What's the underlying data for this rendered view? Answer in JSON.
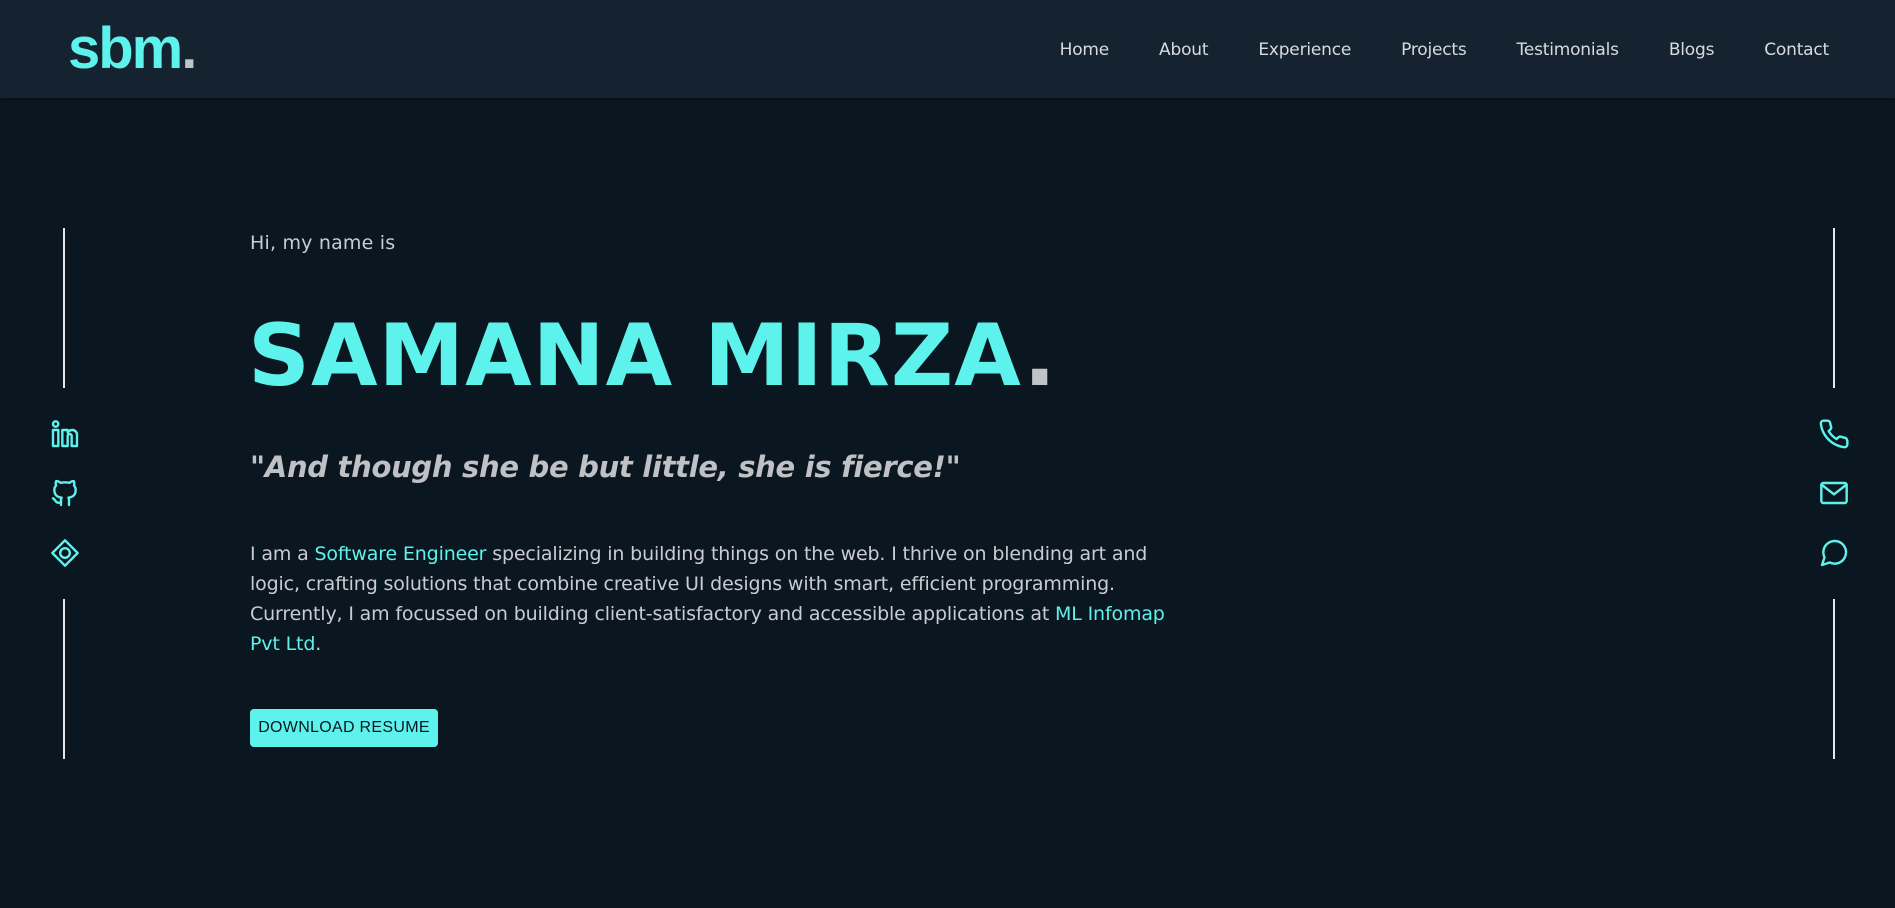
{
  "header": {
    "logo_text": "sbm",
    "logo_dot": ".",
    "nav": [
      "Home",
      "About",
      "Experience",
      "Projects",
      "Testimonials",
      "Blogs",
      "Contact"
    ]
  },
  "hero": {
    "greeting": "Hi, my name is",
    "name": "SAMANA MIRZA",
    "name_dot": ".",
    "quote": "\"And though she be but little, she is fierce!\"",
    "bio": {
      "part1": "I am a ",
      "role": "Software Engineer",
      "part2": " specializing in building things on the web. I thrive on blending art and logic, crafting solutions that combine creative UI designs with smart, efficient programming. Currently, I am focussed on building client-satisfactory and accessible applications at ",
      "company": "ML Infomap Pvt Ltd",
      "part3": "."
    },
    "resume_button": "DOWNLOAD RESUME"
  },
  "left_social": [
    {
      "icon": "linkedin-icon"
    },
    {
      "icon": "github-icon"
    },
    {
      "icon": "location-pin-icon"
    }
  ],
  "right_contact": [
    {
      "icon": "phone-icon"
    },
    {
      "icon": "mail-icon"
    },
    {
      "icon": "chat-icon"
    }
  ],
  "colors": {
    "accent": "#5ef2ec",
    "background": "#0b1720",
    "header_background": "#14232f",
    "text": "#c9ccd1"
  }
}
